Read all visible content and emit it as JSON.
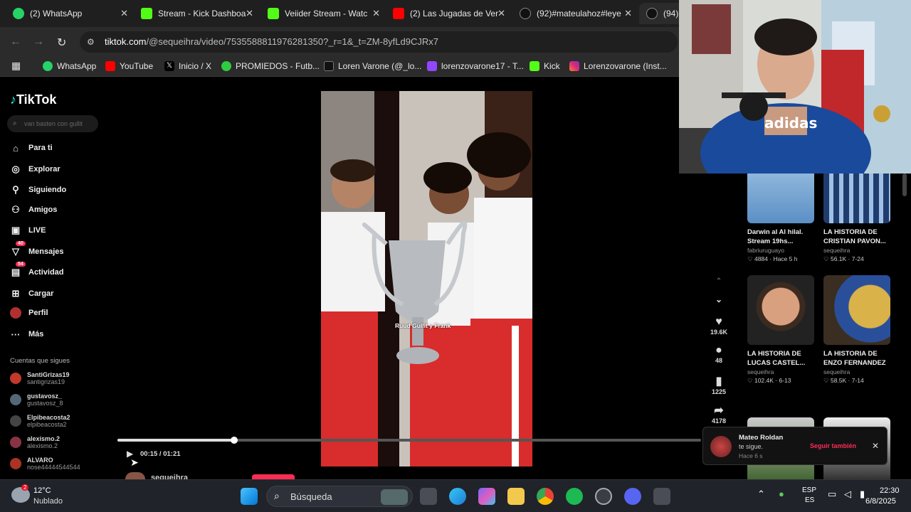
{
  "tabs": [
    {
      "label": "(2) WhatsApp",
      "color": "#25d366"
    },
    {
      "label": "Stream - Kick Dashboa",
      "color": "#53fc18"
    },
    {
      "label": "Veiider Stream - Watc",
      "color": "#53fc18"
    },
    {
      "label": "(2) Las Jugadas de Ver",
      "color": "#ff0000"
    },
    {
      "label": "(92)#mateulahoz#leye",
      "color": "#111111"
    },
    {
      "label": "(94)L",
      "color": "#111111"
    }
  ],
  "address": {
    "domain": "tiktok.com",
    "path": "/@sequeihra/video/7535588811976281350?_r=1&_t=ZM-8yfLd9CJRx7"
  },
  "bookmarks": [
    {
      "label": "WhatsApp",
      "color": "#25d366"
    },
    {
      "label": "YouTube",
      "color": "#ff0000"
    },
    {
      "label": "Inicio / X",
      "color": "#000000"
    },
    {
      "label": "PROMIEDOS - Futb...",
      "color": "#2ecc40"
    },
    {
      "label": "Loren Varone (@_lo...",
      "color": "#111111"
    },
    {
      "label": "lorenzovarone17 - T...",
      "color": "#9146ff"
    },
    {
      "label": "Kick",
      "color": "#53fc18"
    },
    {
      "label": "Lorenzovarone (Inst...",
      "color": "#e1306c"
    }
  ],
  "tiktok": {
    "logo": "TikTok",
    "search_placeholder": "van basten con gullit",
    "nav": [
      {
        "label": "Para ti",
        "icon": "home-icon"
      },
      {
        "label": "Explorar",
        "icon": "compass-icon"
      },
      {
        "label": "Siguiendo",
        "icon": "following-icon"
      },
      {
        "label": "Amigos",
        "icon": "friends-icon"
      },
      {
        "label": "LIVE",
        "icon": "live-icon"
      },
      {
        "label": "Mensajes",
        "icon": "messages-icon",
        "badge": "40"
      },
      {
        "label": "Actividad",
        "icon": "activity-icon",
        "badge": "54"
      },
      {
        "label": "Cargar",
        "icon": "upload-icon"
      },
      {
        "label": "Perfil",
        "icon": "avatar-icon"
      },
      {
        "label": "Más",
        "icon": "more-icon"
      }
    ],
    "following_title": "Cuentas que sigues",
    "following": [
      {
        "name": "SantiGrizas19",
        "handle": "santigrizas19",
        "color": "#c0392b"
      },
      {
        "name": "gustavosz_",
        "handle": "gustavosz_8",
        "color": "#556677"
      },
      {
        "name": "Elpibeacosta2",
        "handle": "elpibeacosta2",
        "color": "#444444"
      },
      {
        "name": "alexismo.2",
        "handle": "alexismo.2",
        "color": "#883344"
      },
      {
        "name": "ALVARO",
        "handle": "nose44444544544",
        "color": "#aa3322"
      }
    ],
    "video": {
      "caption": "Ruud Gullit y Frank",
      "time": "00:15 / 01:21",
      "progress": 0.2,
      "author": "sequeihra"
    },
    "actions": {
      "likes": "19.6K",
      "comments": "48",
      "saves": "1225",
      "shares": "4178"
    },
    "cards": [
      {
        "title": "Darwin al Al hilal. Stream 19hs...",
        "author": "fabriuruguayo",
        "stats": "♡ 4884 · Hace 5 h"
      },
      {
        "title": "LA HISTORIA DE CRISTIAN PAVON...",
        "author": "sequeihra",
        "stats": "♡ 56.1K · 7-24"
      },
      {
        "title": "LA HISTORIA DE LUCAS CASTEL...",
        "author": "sequeihra",
        "stats": "♡ 102.4K · 6-13"
      },
      {
        "title": "LA HISTORIA DE ENZO FERNANDEZ ...",
        "author": "sequeihra",
        "stats": "♡ 58.5K · 7-14"
      }
    ],
    "notification": {
      "name": "Mateo Roldan",
      "text": "te sigue.",
      "time": "Hace 6 s",
      "button": "Seguir también"
    }
  },
  "taskbar": {
    "weather_temp": "12°C",
    "weather_desc": "Nublado",
    "search": "Búsqueda",
    "lang1": "ESP",
    "lang2": "ES",
    "time": "22:30",
    "date": "6/8/2025"
  }
}
